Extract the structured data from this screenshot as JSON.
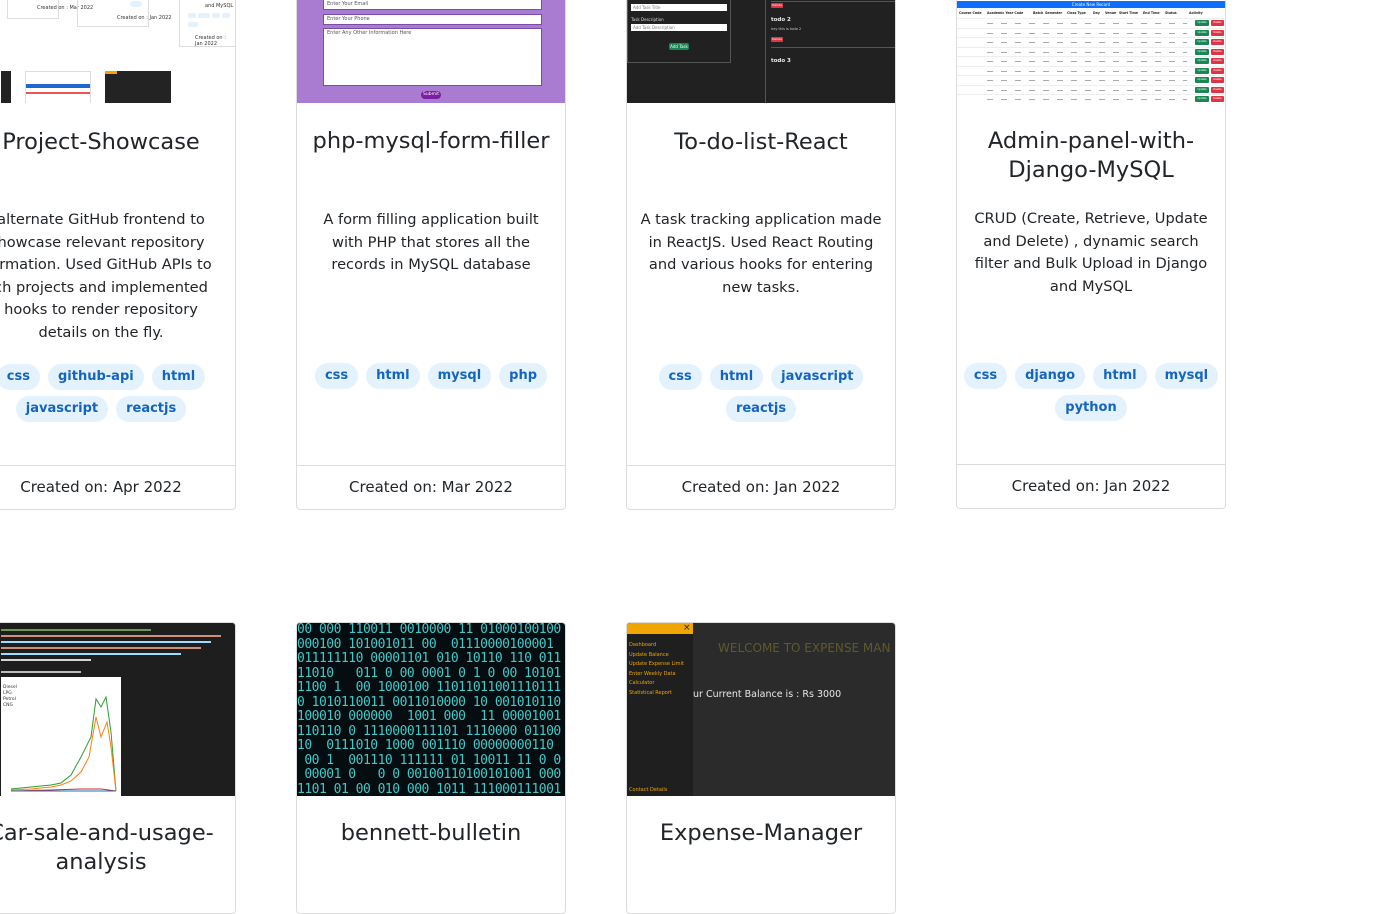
{
  "cards": [
    {
      "title": "Project-Showcase",
      "description": "alternate GitHub frontend to howcase relevant repository ormation. Used GitHub APIs to ch projects and implemented hooks to render repository details on the fly.",
      "description_lines": [
        "alternate GitHub frontend to",
        "howcase relevant repository",
        "ormation. Used GitHub APIs to",
        "ch projects and implemented",
        "hooks to render repository",
        "details on the fly."
      ],
      "tags": [
        "css",
        "github-api",
        "html",
        "javascript",
        "reactjs"
      ],
      "created": "Created on: Apr 2022",
      "thumb": {
        "created_a": "Created on : Mar 2022",
        "created_b": "Created on : Jan 2022",
        "created_c": "Created on : Jan 2022",
        "and_mysql": "and MySQL"
      }
    },
    {
      "title": "php-mysql-form-filler",
      "description_lines": [
        "A form filling application built",
        "with PHP that stores all the",
        "records in MySQL database"
      ],
      "tags": [
        "css",
        "html",
        "mysql",
        "php"
      ],
      "created": "Created on: Mar 2022",
      "thumb": {
        "email_placeholder": "Enter Your Email",
        "phone_placeholder": "Enter Your Phone",
        "other_placeholder": "Enter Any Other Information Here",
        "submit": "Submit"
      }
    },
    {
      "title": "To-do-list-React",
      "description_lines": [
        "A task tracking application made",
        "in ReactJS. Used React Routing",
        "and various hooks for entering",
        "new tasks."
      ],
      "tags": [
        "css",
        "html",
        "javascript",
        "reactjs"
      ],
      "created": "Created on: Jan 2022",
      "thumb": {
        "task_title": "Add Task Title",
        "task_desc_label": "Task Description",
        "task_desc": "Add Task Description",
        "add_task": "Add Task",
        "todo2": "todo 2",
        "todo2_desc": "hey this is todo 2",
        "todo3": "todo 3",
        "delete": "Delete"
      }
    },
    {
      "title": "Admin-panel-with-Django-MySQL",
      "title_lines": [
        "Admin-panel-with-",
        "Django-MySQL"
      ],
      "description_lines": [
        "CRUD (Create, Retrieve, Update",
        "and Delete) , dynamic search",
        "filter and Bulk Upload in Django",
        "and MySQL"
      ],
      "tags": [
        "css",
        "django",
        "html",
        "mysql",
        "python"
      ],
      "created": "Created on: Jan 2022",
      "thumb": {
        "create_button": "Create New Record",
        "headers": [
          "Course Code",
          "Academic Year Code",
          "Batch",
          "Semester",
          "Class Type",
          "Day",
          "Venue",
          "Start Time",
          "End Time",
          "Status",
          "Activity"
        ],
        "update": "Update",
        "delete": "Delete"
      }
    },
    {
      "title_lines": [
        "Car-sale-and-usage-",
        "analysis"
      ],
      "thumb": {
        "legend": [
          "Diesel",
          "LPG",
          "Petrol",
          "CNG"
        ]
      }
    },
    {
      "title": "bennett-bulletin"
    },
    {
      "title": "Expense-Manager",
      "thumb": {
        "close": "×",
        "menu": [
          "Dashboard",
          "Update Balance",
          "Update Expense Limit",
          "Enter Weekly Data",
          "Calculator",
          "Statistical Report"
        ],
        "contact": "Contact Details",
        "welcome": "WELCOME TO EXPENSE MAN",
        "balance": "ur Current Balance is : Rs 3000"
      }
    }
  ],
  "colors": {
    "tag_bg": "#e3f2fd",
    "tag_text": "#1565c0",
    "purple": "#a97bd1",
    "dark": "#212121",
    "blue_header": "#0d6efd",
    "orange": "#f0a500"
  }
}
